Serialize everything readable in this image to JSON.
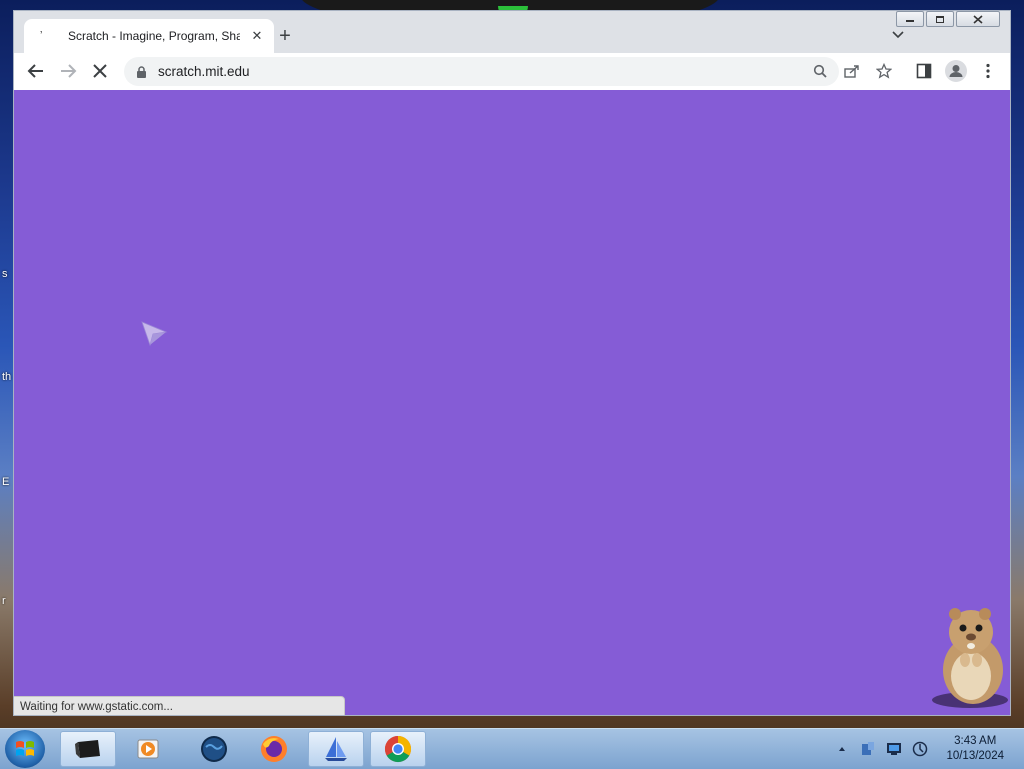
{
  "desktop": {
    "edge_fragments": [
      "s",
      "th",
      "E",
      "r"
    ]
  },
  "browser": {
    "tab": {
      "title": "Scratch - Imagine, Program, Shar",
      "favicon": "loading-spinner-icon",
      "close_icon": "close-icon"
    },
    "new_tab_icon": "plus-icon",
    "tab_search_icon": "chevron-down-icon",
    "window_controls": [
      "minimize",
      "restore",
      "close"
    ],
    "toolbar": {
      "back_icon": "arrow-left-icon",
      "forward_icon": "arrow-right-icon",
      "stop_icon": "close-icon",
      "url": "scratch.mit.edu",
      "omnibox_icons": [
        "search-icon",
        "share-icon",
        "star-icon"
      ],
      "side_panel_icon": "side-panel-icon",
      "profile_icon": "profile-icon",
      "menu_icon": "kebab-menu-icon"
    },
    "page": {
      "background_color": "#855cd6",
      "status_text": "Waiting for www.gstatic.com..."
    }
  },
  "taskbar": {
    "apps": [
      {
        "name": "terminal-app",
        "icon": "console-icon"
      },
      {
        "name": "media-player-app",
        "icon": "media-player-icon"
      },
      {
        "name": "globe-app",
        "icon": "globe-icon"
      },
      {
        "name": "firefox-app",
        "icon": "firefox-icon"
      },
      {
        "name": "sailboat-app",
        "icon": "sailboat-icon"
      },
      {
        "name": "chrome-app",
        "icon": "chrome-icon"
      }
    ],
    "clock": {
      "time": "3:43 AM",
      "date": "10/13/2024"
    }
  }
}
